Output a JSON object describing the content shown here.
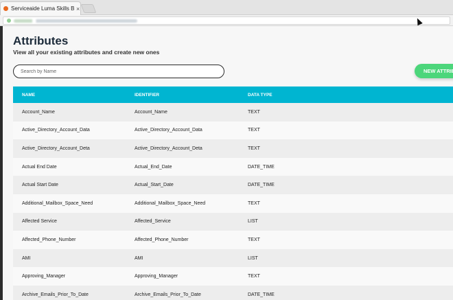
{
  "browser": {
    "tab_title": "Serviceaide Luma Skills Builder",
    "tab_close": "×"
  },
  "page": {
    "title": "Attributes",
    "subtitle": "View all your existing attributes and create new ones",
    "search_placeholder": "Search by Name",
    "new_button_label": "NEW ATTRIBUTE"
  },
  "table": {
    "headers": [
      "NAME",
      "IDENTIFIER",
      "DATA TYPE"
    ],
    "rows": [
      [
        "Account_Name",
        "Account_Name",
        "TEXT"
      ],
      [
        "Active_Directory_Account_Data",
        "Active_Directory_Account_Data",
        "TEXT"
      ],
      [
        "Active_Directory_Account_Deta",
        "Active_Directory_Account_Deta",
        "TEXT"
      ],
      [
        "Actual End Date",
        "Actual_End_Date",
        "DATE_TIME"
      ],
      [
        "Actual Start Date",
        "Actual_Start_Date",
        "DATE_TIME"
      ],
      [
        "Additional_Mailbox_Space_Need",
        "Additional_Mailbox_Space_Need",
        "TEXT"
      ],
      [
        "Affected Service",
        "Affected_Service",
        "LIST"
      ],
      [
        "Affected_Phone_Number",
        "Affected_Phone_Number",
        "TEXT"
      ],
      [
        "AMI",
        "AMI",
        "LIST"
      ],
      [
        "Approving_Manager",
        "Approving_Manager",
        "TEXT"
      ],
      [
        "Archive_Emails_Prior_To_Date",
        "Archive_Emails_Prior_To_Date",
        "DATE_TIME"
      ]
    ]
  },
  "colors": {
    "header": "#00b5d1",
    "accent_button": "#4cd67b"
  }
}
